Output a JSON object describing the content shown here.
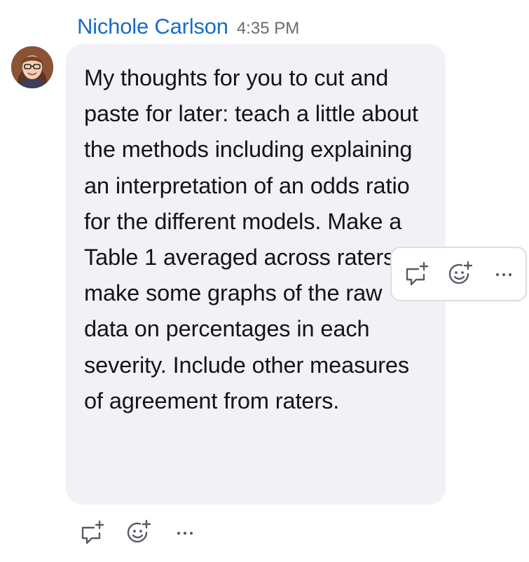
{
  "message": {
    "sender": "Nichole Carlson",
    "time": "4:35 PM",
    "text": "My thoughts for you to cut and paste for later: teach a little about the methods including explaining an interpretation of an odds ratio for the different models. Make a Table 1 averaged across raters or make some graphs of the raw data on percentages in each severity. Include other measures of agreement from raters."
  },
  "hover_toolbar": {
    "actions": [
      "reply-in-thread",
      "add-reaction",
      "more-options"
    ]
  },
  "bottom_actions": {
    "actions": [
      "reply-in-thread",
      "add-reaction",
      "more-options"
    ]
  },
  "colors": {
    "sender": "#1a6bc8",
    "bubble": "#f1f1f6",
    "icon": "#5a5a66"
  }
}
